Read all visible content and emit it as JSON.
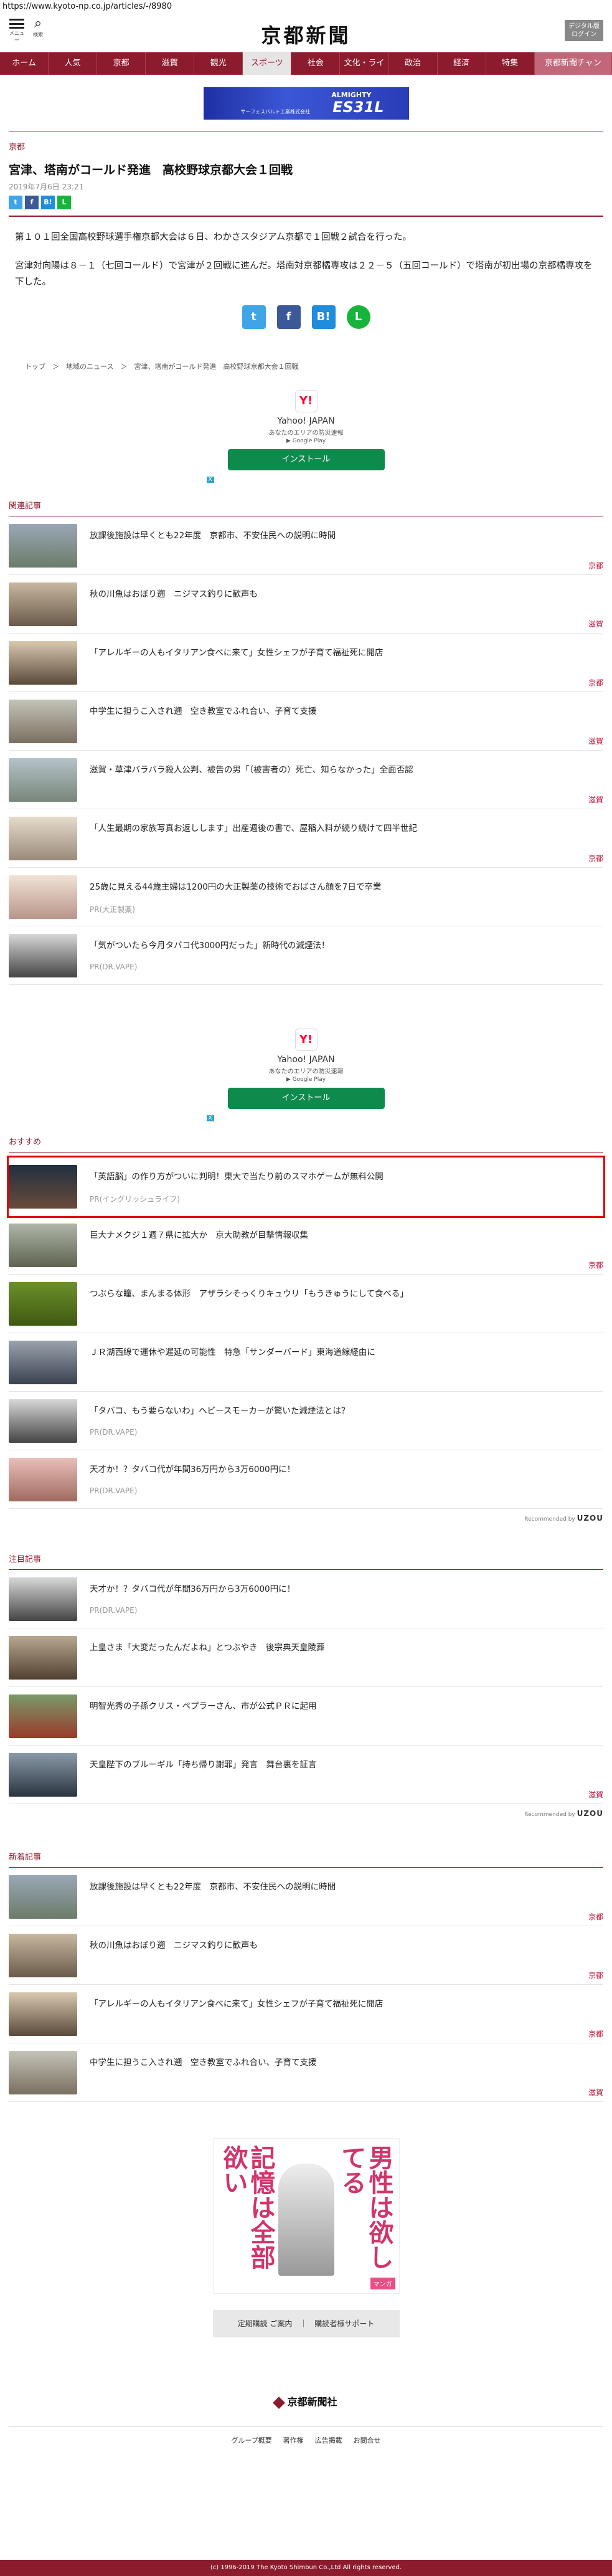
{
  "url": "https://www.kyoto-np.co.jp/articles/-/8980",
  "header": {
    "menu_label": "メニュー",
    "search_label": "検索",
    "logo": "京都新聞",
    "digital_line1": "デジタル版",
    "digital_line2": "ログイン"
  },
  "nav": [
    "ホーム",
    "人気",
    "京都",
    "滋賀",
    "観光",
    "スポーツ",
    "社会",
    "文化・ライフ",
    "政治",
    "経済",
    "特集",
    "京都新聞チャン"
  ],
  "banner_ad": {
    "t1": "ALMIGHTY",
    "t2": "ES31L",
    "t3": "サーフェスバルト工業株式会社"
  },
  "article": {
    "category": "京都",
    "title": "宮津、塔南がコールド発進　高校野球京都大会１回戦",
    "date": "2019年7月6日 23:21",
    "p1": "第１０１回全国高校野球選手権京都大会は６日、わかさスタジアム京都で１回戦２試合を行った。",
    "p2": "宮津対向陽は８－１（七回コールド）で宮津が２回戦に進んだ。塔南対京都橘専攻は２２－５（五回コールド）で塔南が初出場の京都橘専攻を下した。"
  },
  "share": {
    "tw": "t",
    "fb": "f",
    "hb": "B!",
    "ln": "L"
  },
  "breadcrumb": "トップ　＞　地域のニュース　＞　宮津、塔南がコールド発進　高校野球京都大会１回戦",
  "yahoo_ad": {
    "logo": "Y!",
    "name": "Yahoo! JAPAN",
    "sub": "あなたのエリアの防災速報",
    "gp": "▶ Google Play",
    "install": "インストール",
    "adx": "X"
  },
  "related": {
    "heading": "関連記事",
    "items": [
      {
        "title": "放課後施設は早くとも22年度　京都市、不安住民への説明に時間",
        "tag": "京都"
      },
      {
        "title": "秋の川魚はおぼり遡　ニジマス釣りに歓声も",
        "tag": "滋賀"
      },
      {
        "title": "「アレルギーの人もイタリアン食べに来て」女性シェフが子育て福祉死に開店",
        "tag": "京都"
      },
      {
        "title": "中学生に担うこ入され遡　空き教室でふれ合い、子育て支援",
        "tag": "滋賀"
      },
      {
        "title": "滋賀・草津バラバラ殺人公判、被告の男「（被害者の）死亡、知らなかった」全面否認",
        "tag": "滋賀"
      },
      {
        "title": "「人生最期の家族写真お返しします」出産週後の書で、屋稲入料が続り続けて四半世紀",
        "tag": "京都"
      },
      {
        "title": "25歳に見える44歳主婦は1200円の大正製薬の技術でおばさん顔を7日で卒業",
        "pr": "PR(大正製薬)"
      },
      {
        "title": "「気がついたら今月タバコ代3000円だった」新時代の減煙法！",
        "pr": "PR(DR.VAPE)"
      }
    ]
  },
  "recommend": {
    "heading": "おすすめ",
    "items": [
      {
        "title": "「英語脳」の作り方がついに判明！東大で当たり前のスマホゲームが無料公開",
        "pr": "PR(イングリッシュライフ)"
      },
      {
        "title": "巨大ナメクジ１週７県に拡大か　京大助教が目撃情報収集",
        "tag": "京都"
      },
      {
        "title": "つぶらな瞳、まんまる体形　アザラシそっくりキュウリ「もうきゅうにして食べる」",
        "tag": ""
      },
      {
        "title": "ＪＲ湖西線で運休や遅延の可能性　特急「サンダーバード」東海道線経由に",
        "tag": ""
      },
      {
        "title": "「タバコ、もう要らないわ」ヘビースモーカーが驚いた減煙法とは？",
        "pr": "PR(DR.VAPE)"
      },
      {
        "title": "天才か！？タバコ代が年間36万円から3万6000円に！",
        "pr": "PR(DR.VAPE)"
      }
    ]
  },
  "uzou": {
    "label": "Recommended by",
    "brand": "UZOU"
  },
  "attention": {
    "heading": "注目記事",
    "items": [
      {
        "title": "天才か！？タバコ代が年間36万円から3万6000円に！",
        "pr": "PR(DR.VAPE)"
      },
      {
        "title": "上皇さま「大変だったんだよね」とつぶやき　後宗典天皇陵葬",
        "tag": ""
      },
      {
        "title": "明智光秀の子孫クリス・ペプラーさん、市が公式ＰＲに起用",
        "tag": ""
      },
      {
        "title": "天皇陛下のブルーギル「持ち帰り謝罪」発言　舞台裏を証言",
        "tag": "滋賀"
      }
    ]
  },
  "latest": {
    "heading": "新着記事",
    "items": [
      {
        "title": "放課後施設は早くとも22年度　京都市、不安住民への説明に時間",
        "tag": "京都"
      },
      {
        "title": "秋の川魚はおぼり遡　ニジマス釣りに歓声も",
        "tag": "京都"
      },
      {
        "title": "「アレルギーの人もイタリアン食べに来て」女性シェフが子育て福祉死に開店",
        "tag": "京都"
      },
      {
        "title": "中学生に担うこ入され遡　空き教室でふれ合い、子育て支援",
        "tag": "滋賀"
      }
    ]
  },
  "manga_ad": {
    "v1": "記憶は全部欲い",
    "v2": "男性は欲してる",
    "tag": "マンガ"
  },
  "gray_btns": "定期購読 ご案内　｜　購読者様サポート",
  "footer": {
    "logo": "京都新聞社",
    "links": [
      "グループ概要",
      "著作権",
      "広告掲載",
      "お問合せ"
    ],
    "copyright": "(c) 1996-2019 The Kyoto Shimbun Co.,Ltd All rights reserved."
  },
  "colors": {
    "brand": "#8c1b2d",
    "tag": "#c0123a"
  }
}
